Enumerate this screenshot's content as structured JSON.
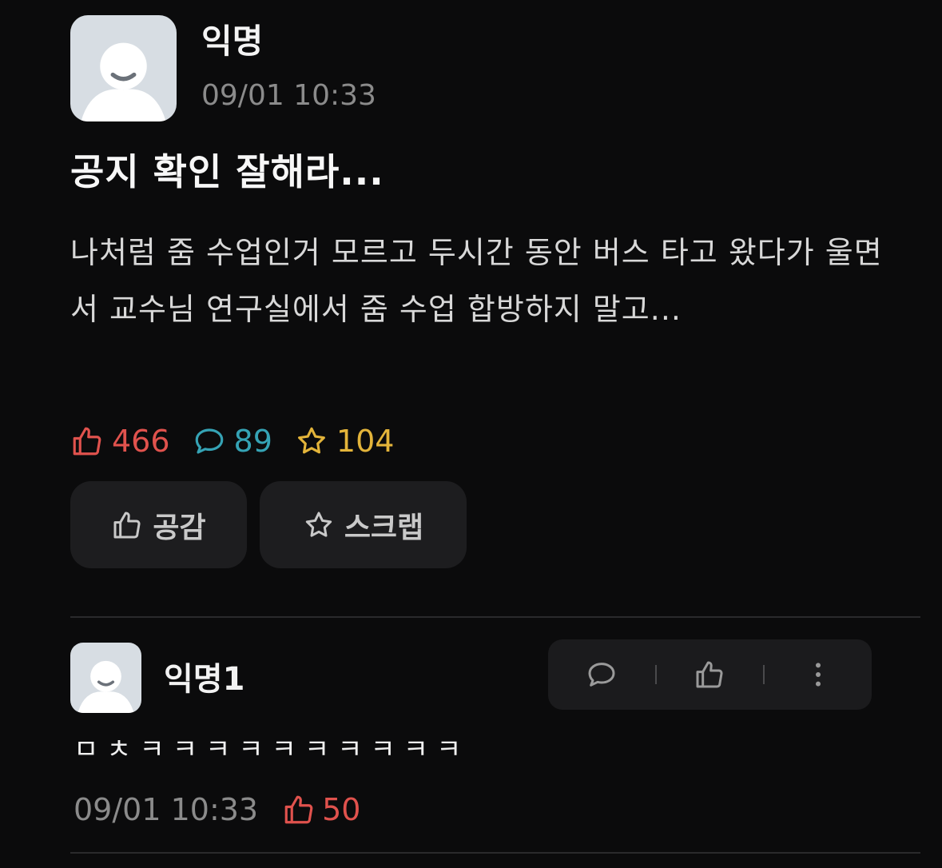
{
  "post": {
    "author": "익명",
    "timestamp": "09/01 10:33",
    "title": "공지 확인 잘해라...",
    "body": "나처럼 줌 수업인거 모르고 두시간 동안 버스 타고 왔다가 울면서 교수님 연구실에서 줌 수업 합방하지 말고...",
    "stats": {
      "likes": "466",
      "comments": "89",
      "scraps": "104",
      "like_icon": "thumbs-up-icon",
      "comment_icon": "speech-bubble-icon",
      "scrap_icon": "star-icon"
    },
    "buttons": {
      "like_label": "공감",
      "scrap_label": "스크랩"
    }
  },
  "comments": [
    {
      "author": "익명1",
      "text": "ㅁㅊㅋㅋㅋㅋㅋㅋㅋㅋㅋㅋ",
      "timestamp": "09/01 10:33",
      "likes": "50",
      "actions": [
        "reply-icon",
        "thumbs-up-icon",
        "more-vertical-icon"
      ]
    }
  ],
  "colors": {
    "background": "#0b0b0c",
    "like_red": "#e0524d",
    "comment_teal": "#35a3b5",
    "scrap_yellow": "#e3b43a"
  }
}
